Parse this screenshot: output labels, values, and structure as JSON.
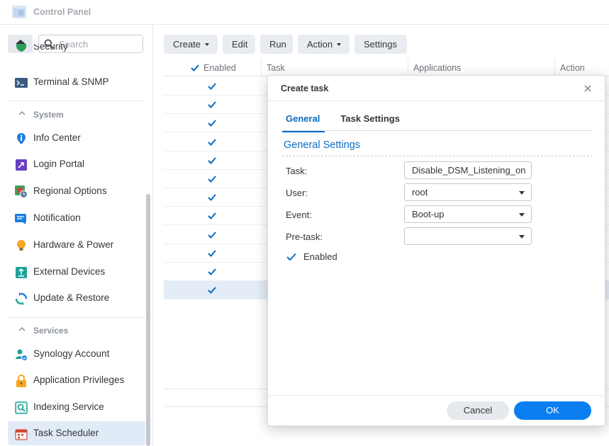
{
  "window": {
    "title": "Control Panel"
  },
  "sidebar": {
    "search_placeholder": "Search",
    "items": [
      {
        "label": "Security",
        "icon": "shield-icon"
      },
      {
        "label": "Terminal & SNMP",
        "icon": "terminal-icon"
      },
      {
        "label": "Info Center",
        "icon": "info-icon"
      },
      {
        "label": "Login Portal",
        "icon": "login-portal-icon"
      },
      {
        "label": "Regional Options",
        "icon": "globe-clock-icon"
      },
      {
        "label": "Notification",
        "icon": "notification-icon"
      },
      {
        "label": "Hardware & Power",
        "icon": "lightbulb-icon"
      },
      {
        "label": "External Devices",
        "icon": "external-device-icon"
      },
      {
        "label": "Update & Restore",
        "icon": "update-icon"
      },
      {
        "label": "Synology Account",
        "icon": "account-icon"
      },
      {
        "label": "Application Privileges",
        "icon": "lock-icon"
      },
      {
        "label": "Indexing Service",
        "icon": "indexing-icon"
      },
      {
        "label": "Task Scheduler",
        "icon": "calendar-icon"
      }
    ],
    "sections": {
      "system": "System",
      "services": "Services"
    },
    "active_item": "Task Scheduler"
  },
  "toolbar": {
    "create": "Create",
    "edit": "Edit",
    "run": "Run",
    "action": "Action",
    "settings": "Settings"
  },
  "grid": {
    "columns": {
      "enabled": "Enabled",
      "task": "Task",
      "applications": "Applications",
      "action": "Action"
    },
    "row_count": 12,
    "selected_row": 12
  },
  "dialog": {
    "title": "Create task",
    "tabs": {
      "general": "General",
      "task_settings": "Task Settings"
    },
    "section_title": "General Settings",
    "fields": {
      "task_label": "Task:",
      "task_value": "Disable_DSM_Listening_on",
      "user_label": "User:",
      "user_value": "root",
      "event_label": "Event:",
      "event_value": "Boot-up",
      "pretask_label": "Pre-task:",
      "pretask_value": ""
    },
    "enabled_label": "Enabled",
    "cancel": "Cancel",
    "ok": "OK"
  },
  "colors": {
    "accent": "#0a6cc2",
    "primary_button": "#0a7ef0",
    "selection": "#e1ebf7"
  }
}
